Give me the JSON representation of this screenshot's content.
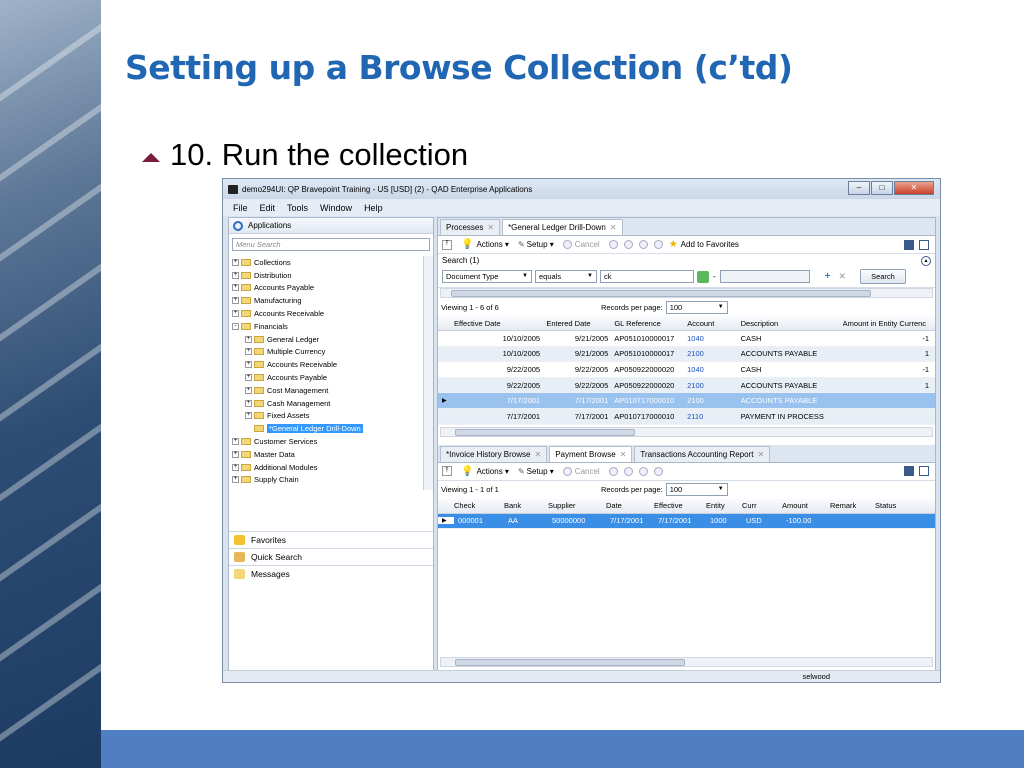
{
  "slide": {
    "title": "Setting up a Browse Collection (c’td)",
    "bullet": "10. Run the collection"
  },
  "window": {
    "title": "demo294UI: QP Bravepoint Training - US [USD] (2) - QAD Enterprise Applications",
    "menu": [
      "File",
      "Edit",
      "Tools",
      "Window",
      "Help"
    ],
    "status_user": "selwood"
  },
  "leftpane": {
    "header": "Applications",
    "search_placeholder": "Menu Search",
    "tree": [
      {
        "label": "Collections",
        "level": 0,
        "sign": "+"
      },
      {
        "label": "Distribution",
        "level": 0,
        "sign": "+"
      },
      {
        "label": "Accounts Payable",
        "level": 0,
        "sign": "+"
      },
      {
        "label": "Manufacturing",
        "level": 0,
        "sign": "+"
      },
      {
        "label": "Accounts Receivable",
        "level": 0,
        "sign": "+"
      },
      {
        "label": "Financials",
        "level": 0,
        "sign": "-"
      },
      {
        "label": "General Ledger",
        "level": 1,
        "sign": "+"
      },
      {
        "label": "Multiple Currency",
        "level": 1,
        "sign": "+"
      },
      {
        "label": "Accounts Receivable",
        "level": 1,
        "sign": "+"
      },
      {
        "label": "Accounts Payable",
        "level": 1,
        "sign": "+"
      },
      {
        "label": "Cost Management",
        "level": 1,
        "sign": "+"
      },
      {
        "label": "Cash Management",
        "level": 1,
        "sign": "+"
      },
      {
        "label": "Fixed Assets",
        "level": 1,
        "sign": "+"
      },
      {
        "label": "*General Ledger Drill-Down",
        "level": 1,
        "sign": "",
        "selected": true
      },
      {
        "label": "Customer Services",
        "level": 0,
        "sign": "+"
      },
      {
        "label": "Master Data",
        "level": 0,
        "sign": "+"
      },
      {
        "label": "Additional Modules",
        "level": 0,
        "sign": "+"
      },
      {
        "label": "Supply Chain",
        "level": 0,
        "sign": "+"
      }
    ],
    "nav": [
      "Favorites",
      "Quick Search",
      "Messages"
    ]
  },
  "top": {
    "tabs": [
      "Processes",
      "*General Ledger Drill-Down"
    ],
    "toolbar": {
      "actions": "Actions",
      "setup": "Setup",
      "cancel": "Cancel",
      "favorites": "Add to Favorites"
    },
    "search_label": "Search (1)",
    "search_field": "Document Type",
    "search_op": "equals",
    "search_value": "ck",
    "search_dash": "-",
    "search_button": "Search",
    "viewing": "Viewing  1 - 6  of  6",
    "records_label": "Records per page:",
    "records_value": "100",
    "columns": [
      "Effective Date",
      "Entered Date",
      "GL Reference",
      "Account",
      "Description",
      "Amount in Entity Currenc"
    ],
    "rows": [
      [
        "10/10/2005",
        "9/21/2005",
        "AP051010000017",
        "1040",
        "CASH",
        "-1"
      ],
      [
        "10/10/2005",
        "9/21/2005",
        "AP051010000017",
        "2100",
        "ACCOUNTS PAYABLE",
        "1"
      ],
      [
        "9/22/2005",
        "9/22/2005",
        "AP050922000020",
        "1040",
        "CASH",
        "-1"
      ],
      [
        "9/22/2005",
        "9/22/2005",
        "AP050922000020",
        "2100",
        "ACCOUNTS PAYABLE",
        "1"
      ],
      [
        "7/17/2001",
        "7/17/2001",
        "AP010717000010",
        "2100",
        "ACCOUNTS PAYABLE",
        ""
      ],
      [
        "7/17/2001",
        "7/17/2001",
        "AP010717000010",
        "2110",
        "PAYMENT IN PROCESS",
        ""
      ]
    ]
  },
  "bottom": {
    "tabs": [
      "*Invoice History Browse",
      "Payment Browse",
      "Transactions Accounting Report"
    ],
    "toolbar": {
      "actions": "Actions",
      "setup": "Setup",
      "cancel": "Cancel"
    },
    "viewing": "Viewing  1 - 1  of  1",
    "records_label": "Records per page:",
    "records_value": "100",
    "columns": [
      "Check",
      "Bank",
      "Supplier",
      "Date",
      "Effective",
      "Entity",
      "Curr",
      "Amount",
      "Remark",
      "Status"
    ],
    "rows": [
      [
        "000001",
        "AA",
        "50000000",
        "7/17/2001",
        "7/17/2001",
        "1000",
        "USD",
        "-100.00",
        "",
        ""
      ]
    ]
  },
  "colors": {
    "title": "#2166b3",
    "bullet_marker": "#7c1c3c",
    "selection": "#3a8ee6",
    "bottom_bar": "#4f7fc2"
  }
}
